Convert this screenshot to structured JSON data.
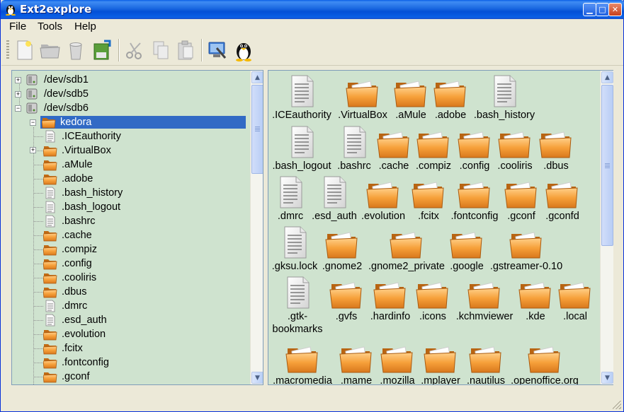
{
  "window": {
    "title": "Ext2explore"
  },
  "menu": {
    "items": [
      "File",
      "Tools",
      "Help"
    ]
  },
  "toolbar": {
    "tools": [
      "new-file-icon",
      "open-folder-icon",
      "delete-icon",
      "save-icon",
      "cut-icon",
      "copy-icon",
      "paste-icon",
      "settings-icon",
      "tux-icon"
    ]
  },
  "tree": {
    "roots": [
      "/dev/sdb1",
      "/dev/sdb5",
      "/dev/sdb6"
    ],
    "selected": "kedora",
    "children": [
      ".ICEauthority",
      ".VirtualBox",
      ".aMule",
      ".adobe",
      ".bash_history",
      ".bash_logout",
      ".bashrc",
      ".cache",
      ".compiz",
      ".config",
      ".cooliris",
      ".dbus",
      ".dmrc",
      ".esd_auth",
      ".evolution",
      ".fcitx",
      ".fontconfig",
      ".gconf"
    ]
  },
  "files": {
    "row1": [
      ".ICEauthority",
      ".VirtualBox",
      ".aMule",
      ".adobe",
      ".bash_history"
    ],
    "row2": [
      ".bash_logout",
      ".bashrc",
      ".cache",
      ".compiz",
      ".config",
      ".cooliris",
      ".dbus"
    ],
    "row3": [
      ".dmrc",
      ".esd_auth",
      ".evolution",
      ".fcitx",
      ".fontconfig",
      ".gconf",
      ".gconfd"
    ],
    "row4": [
      ".gksu.lock",
      ".gnome2",
      ".gnome2_private",
      ".google",
      ".gstreamer-0.10"
    ],
    "row5": [
      ".gtk-bookmarks",
      ".gvfs",
      ".hardinfo",
      ".icons",
      ".kchmviewer",
      ".kde",
      ".local"
    ],
    "row6": [
      ".macromedia",
      ".mame",
      ".mozilla",
      ".mplayer",
      ".nautilus",
      ".openoffice.org"
    ]
  },
  "colors": {
    "panel_bg": "#cfe3cf",
    "selection": "#316ac5",
    "folder": "#f5a13c"
  }
}
